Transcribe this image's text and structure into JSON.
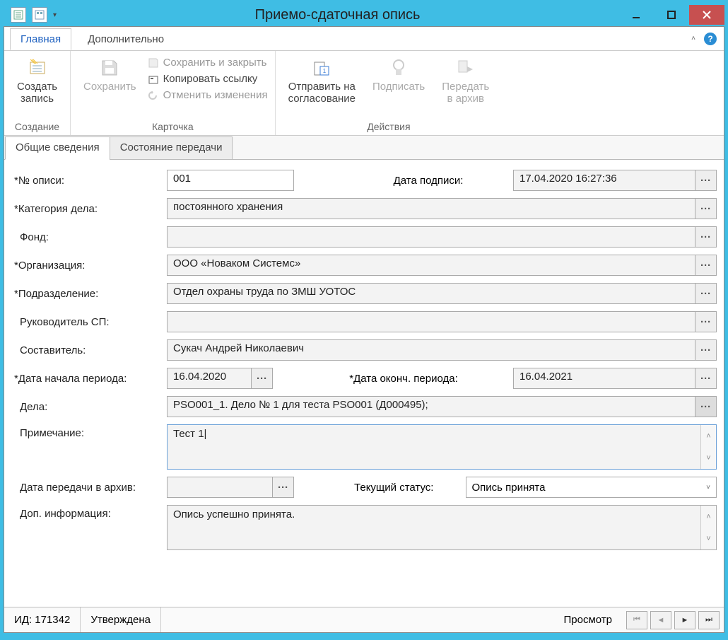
{
  "window": {
    "title": "Приемо-сдаточная опись"
  },
  "ribbon": {
    "tabs": {
      "main": "Главная",
      "additional": "Дополнительно"
    },
    "groups": {
      "create": {
        "label": "Создание",
        "new_record": "Создать\nзапись"
      },
      "card": {
        "label": "Карточка",
        "save": "Сохранить",
        "save_close": "Сохранить и закрыть",
        "copy_link": "Копировать ссылку",
        "undo": "Отменить изменения"
      },
      "actions": {
        "label": "Действия",
        "send_approval": "Отправить на\nсогласование",
        "sign": "Подписать",
        "transfer": "Передать\nв архив"
      }
    }
  },
  "page_tabs": {
    "general": "Общие сведения",
    "transfer_state": "Состояние передачи"
  },
  "form": {
    "number_label": "*№ описи:",
    "number_value": "001",
    "sign_date_label": "Дата подписи:",
    "sign_date_value": "17.04.2020 16:27:36",
    "category_label": "*Категория дела:",
    "category_value": "постоянного хранения",
    "fund_label": "Фонд:",
    "fund_value": "",
    "org_label": "*Организация:",
    "org_value": "ООО «Новаком Системс»",
    "dept_label": "*Подразделение:",
    "dept_value": "Отдел охраны труда по ЗМШ УОТОС",
    "head_label": "Руководитель СП:",
    "head_value": "",
    "author_label": "Составитель:",
    "author_value": "Сукач Андрей Николаевич",
    "period_start_label": "*Дата начала периода:",
    "period_start_value": "16.04.2020",
    "period_end_label": "*Дата оконч. периода:",
    "period_end_value": "16.04.2021",
    "cases_label": "Дела:",
    "cases_value": "PSO001_1. Дело № 1 для теста PSO001 (Д000495);",
    "note_label": "Примечание:",
    "note_value": "Тест 1|",
    "archive_date_label": "Дата передачи в архив:",
    "archive_date_value": "",
    "status_label": "Текущий статус:",
    "status_value": "Опись принята",
    "extra_label": "Доп. информация:",
    "extra_value": "Опись успешно принята."
  },
  "statusbar": {
    "id": "ИД: 171342",
    "state": "Утверждена",
    "mode": "Просмотр"
  }
}
